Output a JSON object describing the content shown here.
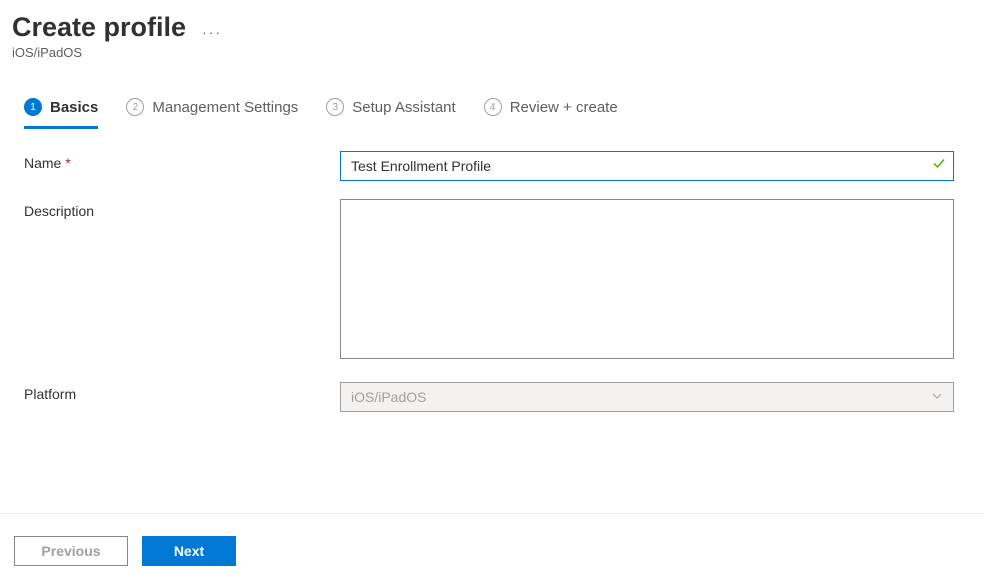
{
  "header": {
    "title": "Create profile",
    "subtitle": "iOS/iPadOS"
  },
  "wizard": {
    "tabs": [
      {
        "num": "1",
        "label": "Basics",
        "active": true
      },
      {
        "num": "2",
        "label": "Management Settings",
        "active": false
      },
      {
        "num": "3",
        "label": "Setup Assistant",
        "active": false
      },
      {
        "num": "4",
        "label": "Review + create",
        "active": false
      }
    ]
  },
  "form": {
    "name": {
      "label": "Name",
      "value": "Test Enrollment Profile"
    },
    "description": {
      "label": "Description",
      "value": ""
    },
    "platform": {
      "label": "Platform",
      "value": "iOS/iPadOS"
    }
  },
  "footer": {
    "previous": "Previous",
    "next": "Next"
  }
}
